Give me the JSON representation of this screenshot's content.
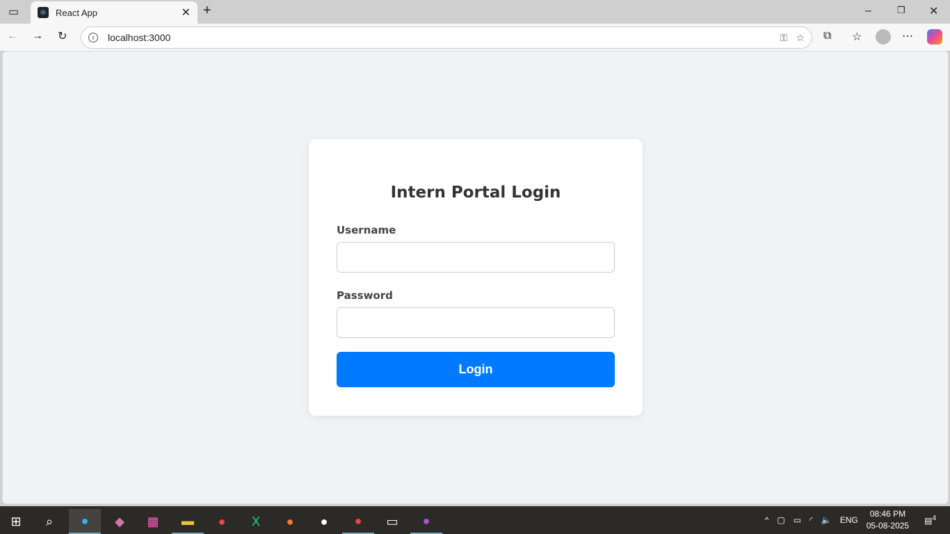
{
  "browser": {
    "tab_title": "React App",
    "url": "localhost:3000"
  },
  "login": {
    "title": "Intern Portal Login",
    "username_label": "Username",
    "username_value": "",
    "password_label": "Password",
    "password_value": "",
    "button": "Login",
    "accent": "#007bff"
  },
  "taskbar": {
    "time": "08:46 PM",
    "date": "05-08-2025",
    "lang": "ENG",
    "notifications": "4"
  }
}
